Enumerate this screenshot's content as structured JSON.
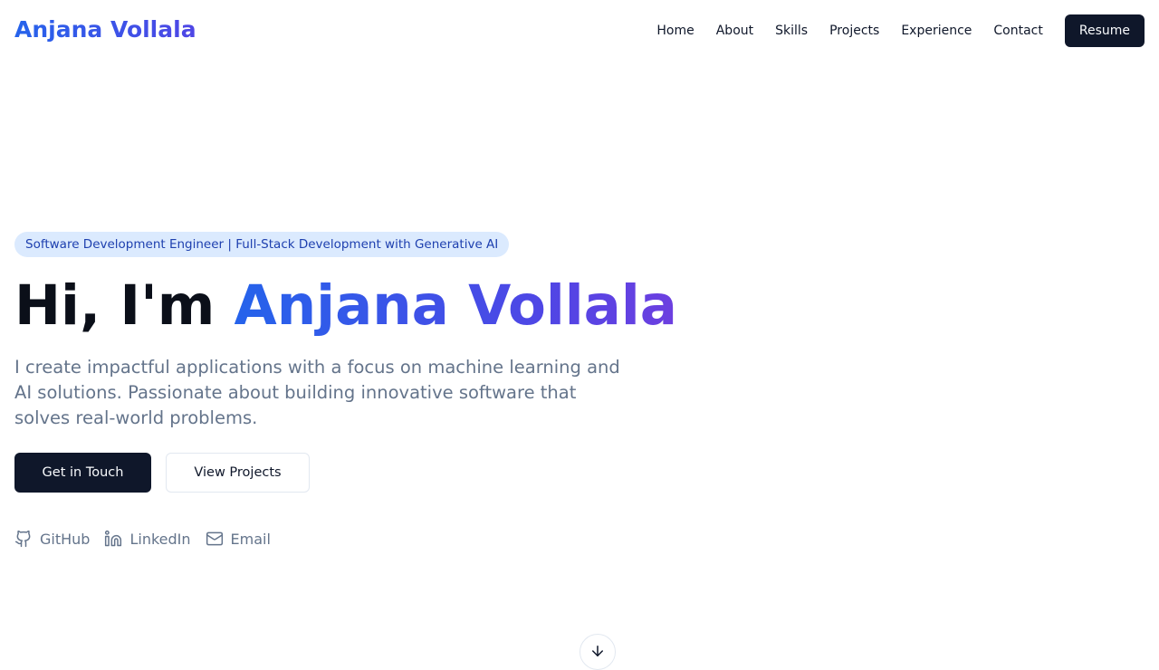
{
  "header": {
    "logo": "Anjana Vollala",
    "nav": [
      "Home",
      "About",
      "Skills",
      "Projects",
      "Experience",
      "Contact"
    ],
    "resume_label": "Resume"
  },
  "hero": {
    "badge": "Software Development Engineer | Full-Stack Development with Generative AI",
    "greeting": "Hi, I'm ",
    "name": "Anjana Vollala",
    "description": "I create impactful applications with a focus on machine learning and AI solutions. Passionate about building innovative software that solves real-world problems.",
    "primary_button": "Get in Touch",
    "secondary_button": "View Projects",
    "socials": [
      {
        "label": "GitHub",
        "icon": "github-icon"
      },
      {
        "label": "LinkedIn",
        "icon": "linkedin-icon"
      },
      {
        "label": "Email",
        "icon": "mail-icon"
      }
    ]
  },
  "colors": {
    "accent_start": "#2563eb",
    "accent_end": "#4f46e5",
    "dark_button": "#0f172a",
    "badge_bg": "#dbeafe",
    "badge_text": "#1e40af",
    "muted_text": "#64748b"
  }
}
